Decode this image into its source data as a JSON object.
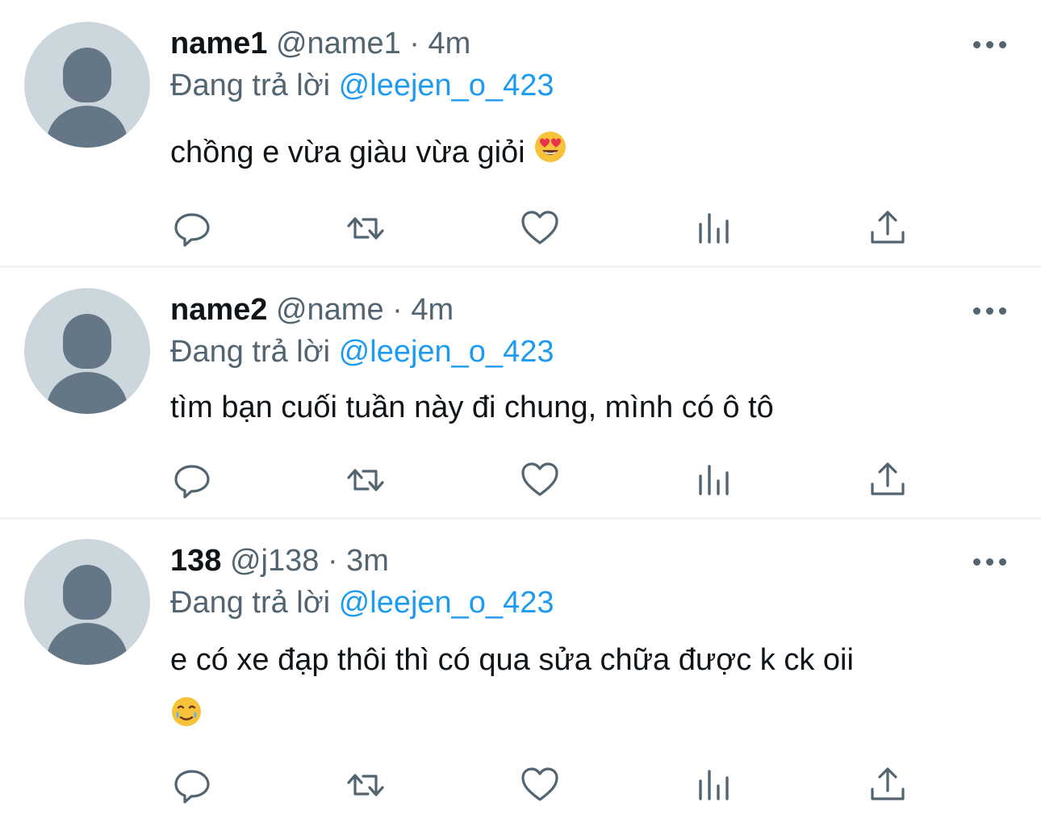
{
  "tweets": [
    {
      "name": "name1",
      "handle": "@name1",
      "sep": " · ",
      "time": "4m",
      "replying_prefix": "Đang trả lời ",
      "replying_to": "@leejen_o_423",
      "text_line1": "chồng e vừa giàu vừa giỏi",
      "emoji": "heart-eyes-emoji"
    },
    {
      "name": "name2",
      "handle": "@name",
      "sep": " · ",
      "time": "4m",
      "replying_prefix": "Đang trả lời ",
      "replying_to": "@leejen_o_423",
      "text_line1": "tìm bạn cuối tuần này đi chung, mình có ô tô"
    },
    {
      "name": "138",
      "handle": "@j138",
      "sep": " · ",
      "time": "3m",
      "replying_prefix": "Đang trả lời ",
      "replying_to": "@leejen_o_423",
      "text_line1": "e có xe đạp thôi thì có qua sửa chữa được k ck oii",
      "emoji": "crying-smile-emoji"
    }
  ],
  "icons": {
    "reply": "reply-icon",
    "retweet": "retweet-icon",
    "like": "heart-icon",
    "views": "views-icon",
    "share": "share-icon",
    "more": "more-icon"
  },
  "colors": {
    "text": "#0f1419",
    "secondary": "#536471",
    "mention": "#1d9bf0",
    "avatar_bg": "#ccd6dd",
    "avatar_fg": "#657786",
    "divider": "#eff3f4"
  }
}
